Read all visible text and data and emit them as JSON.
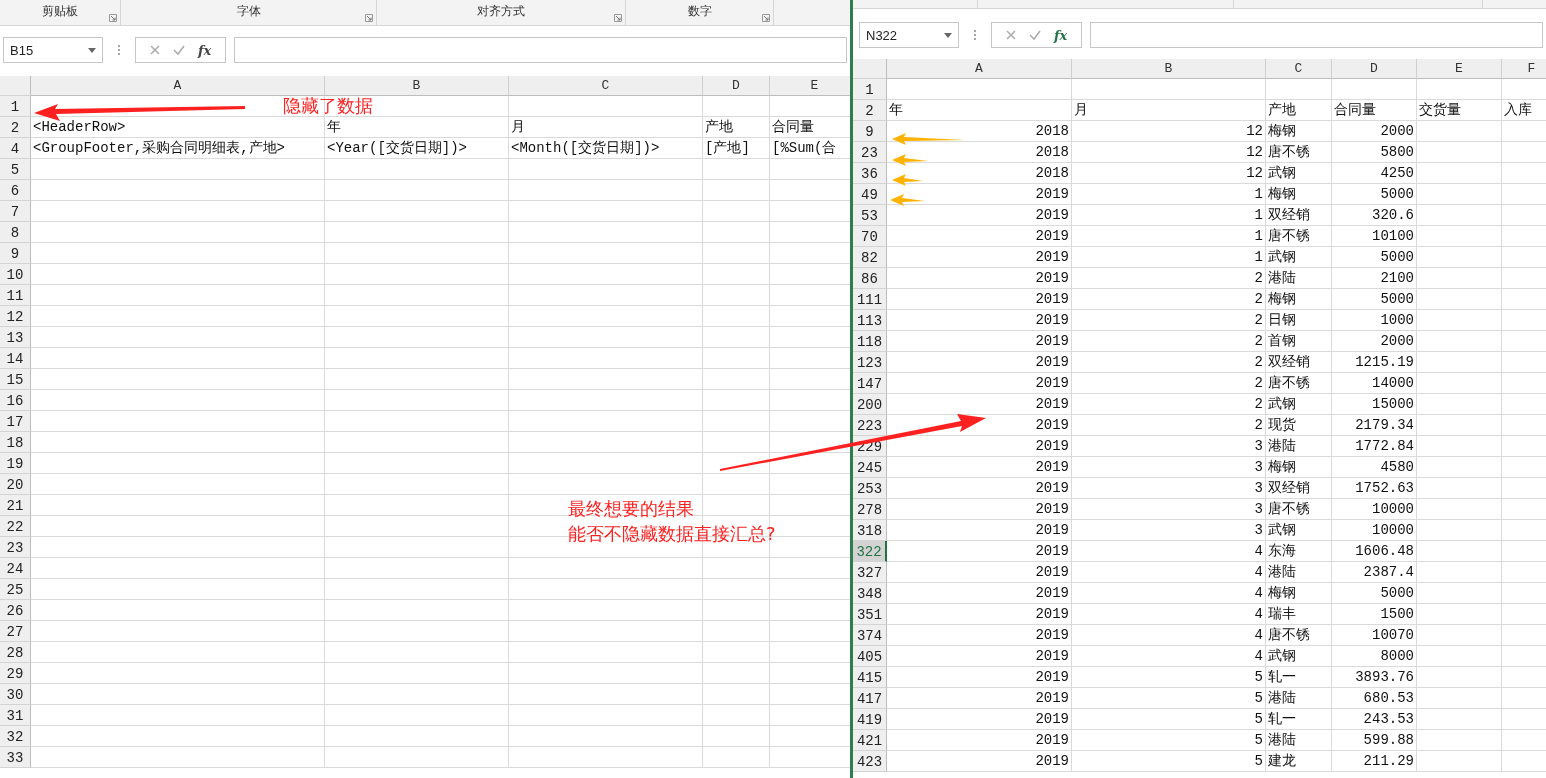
{
  "left_window": {
    "ribbon_groups": [
      "剪贴板",
      "字体",
      "对齐方式",
      "数字"
    ],
    "name_box": "B15",
    "function_button": "fx",
    "columns": [
      "A",
      "B",
      "C",
      "D",
      "E"
    ],
    "rows": [
      {
        "number": "1"
      },
      {
        "number": "2",
        "cells": [
          "<HeaderRow>",
          "年",
          "月",
          "产地",
          "合同量"
        ]
      },
      {
        "number": "4",
        "cells": [
          "<GroupFooter,采购合同明细表,产地>",
          "<Year([交货日期])>",
          "<Month([交货日期])>",
          "[产地]",
          "[%Sum(合"
        ]
      },
      {
        "number": "5"
      },
      {
        "number": "6"
      },
      {
        "number": "7"
      },
      {
        "number": "8"
      },
      {
        "number": "9"
      },
      {
        "number": "10"
      },
      {
        "number": "11"
      },
      {
        "number": "12"
      },
      {
        "number": "13"
      },
      {
        "number": "14"
      },
      {
        "number": "15"
      },
      {
        "number": "16"
      },
      {
        "number": "17"
      },
      {
        "number": "18"
      },
      {
        "number": "19"
      },
      {
        "number": "20"
      },
      {
        "number": "21"
      },
      {
        "number": "22"
      },
      {
        "number": "23"
      },
      {
        "number": "24"
      },
      {
        "number": "25"
      },
      {
        "number": "26"
      },
      {
        "number": "27"
      },
      {
        "number": "28"
      },
      {
        "number": "29"
      },
      {
        "number": "30"
      },
      {
        "number": "31"
      },
      {
        "number": "32"
      },
      {
        "number": "33"
      }
    ]
  },
  "right_window": {
    "name_box": "N322",
    "function_button": "fx",
    "columns": [
      "A",
      "B",
      "C",
      "D",
      "E",
      "F"
    ],
    "rows": [
      {
        "number": "1",
        "kind": "header",
        "selected": false
      },
      {
        "number": "2",
        "kind": "header",
        "selected": false,
        "cells": [
          "年",
          "月",
          "产地",
          "合同量",
          "交货量",
          "入库"
        ]
      },
      {
        "number": "9",
        "kind": "record",
        "selected": false,
        "cells": [
          "2018",
          "12",
          "梅钢",
          "2000"
        ]
      },
      {
        "number": "23",
        "kind": "record",
        "selected": false,
        "cells": [
          "2018",
          "12",
          "唐不锈",
          "5800"
        ]
      },
      {
        "number": "36",
        "kind": "record",
        "selected": false,
        "cells": [
          "2018",
          "12",
          "武钢",
          "4250"
        ]
      },
      {
        "number": "49",
        "kind": "record",
        "selected": false,
        "cells": [
          "2019",
          "1",
          "梅钢",
          "5000"
        ]
      },
      {
        "number": "53",
        "kind": "record",
        "selected": false,
        "cells": [
          "2019",
          "1",
          "双经销",
          "320.6"
        ]
      },
      {
        "number": "70",
        "kind": "record",
        "selected": false,
        "cells": [
          "2019",
          "1",
          "唐不锈",
          "10100"
        ]
      },
      {
        "number": "82",
        "kind": "record",
        "selected": false,
        "cells": [
          "2019",
          "1",
          "武钢",
          "5000"
        ]
      },
      {
        "number": "86",
        "kind": "record",
        "selected": false,
        "cells": [
          "2019",
          "2",
          "港陆",
          "2100"
        ]
      },
      {
        "number": "111",
        "kind": "record",
        "selected": false,
        "cells": [
          "2019",
          "2",
          "梅钢",
          "5000"
        ]
      },
      {
        "number": "113",
        "kind": "record",
        "selected": false,
        "cells": [
          "2019",
          "2",
          "日钢",
          "1000"
        ]
      },
      {
        "number": "118",
        "kind": "record",
        "selected": false,
        "cells": [
          "2019",
          "2",
          "首钢",
          "2000"
        ]
      },
      {
        "number": "123",
        "kind": "record",
        "selected": false,
        "cells": [
          "2019",
          "2",
          "双经销",
          "1215.19"
        ]
      },
      {
        "number": "147",
        "kind": "record",
        "selected": false,
        "cells": [
          "2019",
          "2",
          "唐不锈",
          "14000"
        ]
      },
      {
        "number": "200",
        "kind": "record",
        "selected": false,
        "cells": [
          "2019",
          "2",
          "武钢",
          "15000"
        ]
      },
      {
        "number": "223",
        "kind": "record",
        "selected": false,
        "cells": [
          "2019",
          "2",
          "现货",
          "2179.34"
        ]
      },
      {
        "number": "229",
        "kind": "record",
        "selected": false,
        "cells": [
          "2019",
          "3",
          "港陆",
          "1772.84"
        ]
      },
      {
        "number": "245",
        "kind": "record",
        "selected": false,
        "cells": [
          "2019",
          "3",
          "梅钢",
          "4580"
        ]
      },
      {
        "number": "253",
        "kind": "record",
        "selected": false,
        "cells": [
          "2019",
          "3",
          "双经销",
          "1752.63"
        ]
      },
      {
        "number": "278",
        "kind": "record",
        "selected": false,
        "cells": [
          "2019",
          "3",
          "唐不锈",
          "10000"
        ]
      },
      {
        "number": "318",
        "kind": "record",
        "selected": false,
        "cells": [
          "2019",
          "3",
          "武钢",
          "10000"
        ]
      },
      {
        "number": "322",
        "kind": "record",
        "selected": true,
        "cells": [
          "2019",
          "4",
          "东海",
          "1606.48"
        ]
      },
      {
        "number": "327",
        "kind": "record",
        "selected": false,
        "cells": [
          "2019",
          "4",
          "港陆",
          "2387.4"
        ]
      },
      {
        "number": "348",
        "kind": "record",
        "selected": false,
        "cells": [
          "2019",
          "4",
          "梅钢",
          "5000"
        ]
      },
      {
        "number": "351",
        "kind": "record",
        "selected": false,
        "cells": [
          "2019",
          "4",
          "瑞丰",
          "1500"
        ]
      },
      {
        "number": "374",
        "kind": "record",
        "selected": false,
        "cells": [
          "2019",
          "4",
          "唐不锈",
          "10070"
        ]
      },
      {
        "number": "405",
        "kind": "record",
        "selected": false,
        "cells": [
          "2019",
          "4",
          "武钢",
          "8000"
        ]
      },
      {
        "number": "415",
        "kind": "record",
        "selected": false,
        "cells": [
          "2019",
          "5",
          "轧一",
          "3893.76"
        ]
      },
      {
        "number": "417",
        "kind": "record",
        "selected": false,
        "cells": [
          "2019",
          "5",
          "港陆",
          "680.53"
        ]
      },
      {
        "number": "419",
        "kind": "record",
        "selected": false,
        "cells": [
          "2019",
          "5",
          "轧一",
          "243.53"
        ]
      },
      {
        "number": "421",
        "kind": "record",
        "selected": false,
        "cells": [
          "2019",
          "5",
          "港陆",
          "599.88"
        ]
      },
      {
        "number": "423",
        "kind": "record",
        "selected": false,
        "cells": [
          "2019",
          "5",
          "建龙",
          "211.29"
        ]
      }
    ]
  },
  "annotations": [
    {
      "lines": [
        "隐藏了数据"
      ]
    },
    {
      "lines": [
        "最终想要的结果",
        "能否不隐藏数据直接汇总?"
      ]
    }
  ]
}
